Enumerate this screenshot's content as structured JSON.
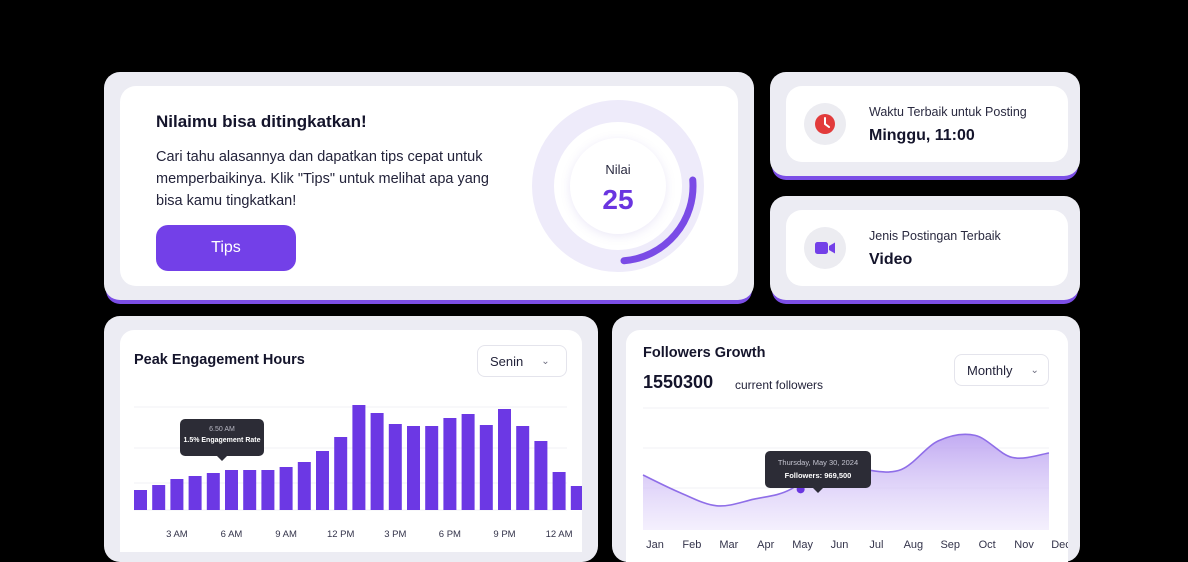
{
  "score": {
    "title": "Nilaimu bisa ditingkatkan!",
    "description": "Cari tahu alasannya dan dapatkan tips cepat untuk memperbaikinya. Klik \"Tips\" untuk melihat apa yang bisa kamu tingkatkan!",
    "button_label": "Tips",
    "gauge_label": "Nilai",
    "value": "25",
    "progress_fraction": 0.25,
    "accent_color": "#7340e8"
  },
  "best_time": {
    "label": "Waktu Terbaik untuk Posting",
    "value": "Minggu, 11:00",
    "icon": "clock-icon",
    "icon_color": "#e23b3b"
  },
  "best_type": {
    "label": "Jenis Postingan Terbaik",
    "value": "Video",
    "icon": "video-camera-icon",
    "icon_color": "#7340e8"
  },
  "peak": {
    "title": "Peak Engagement Hours",
    "dropdown_value": "Senin",
    "tooltip_time": "6.50 AM",
    "tooltip_text": "1.5% Engagement Rate"
  },
  "followers": {
    "title": "Followers Growth",
    "count": "1550300",
    "count_label": "current followers",
    "dropdown_value": "Monthly",
    "tooltip_date": "Thursday, May 30, 2024",
    "tooltip_value": "Followers: 969,500"
  },
  "chart_data": [
    {
      "type": "bar",
      "title": "Peak Engagement Hours",
      "tick_labels": [
        "3 AM",
        "6 AM",
        "9 AM",
        "12 PM",
        "3 PM",
        "6 PM",
        "9 PM",
        "12 AM"
      ],
      "values": [
        20,
        25,
        31,
        34,
        37,
        40,
        40,
        40,
        43,
        48,
        59,
        73,
        105,
        97,
        86,
        84,
        84,
        92,
        96,
        85,
        101,
        84,
        69,
        38,
        24
      ],
      "highlight_index": 5,
      "ylim": [
        0,
        120
      ],
      "color": "#6c38e4"
    },
    {
      "type": "area",
      "title": "Followers Growth",
      "categories": [
        "Jan",
        "Feb",
        "Mar",
        "Apr",
        "May",
        "Jun",
        "Jul",
        "Aug",
        "Sep",
        "Oct",
        "Nov",
        "Dec"
      ],
      "values": [
        1100000,
        940000,
        820000,
        880000,
        969500,
        1240000,
        1150000,
        1150000,
        1410000,
        1460000,
        1260000,
        1300000
      ],
      "highlight_index": 4,
      "ylim": [
        600000,
        1600000
      ],
      "color": "#8f6ee8"
    }
  ]
}
